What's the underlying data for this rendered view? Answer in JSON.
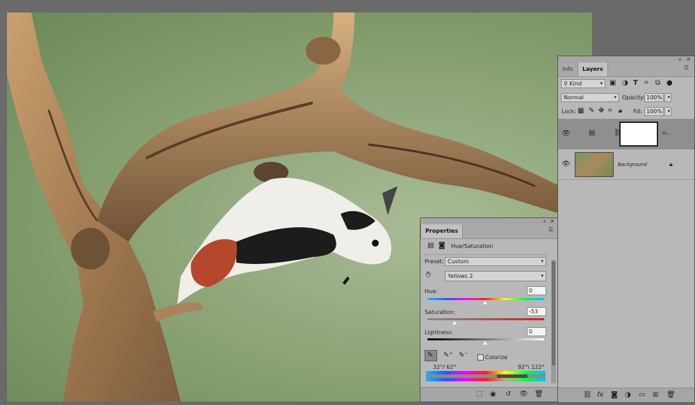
{
  "layers_panel": {
    "tabs": [
      {
        "label": "Info"
      },
      {
        "label": "Layers"
      }
    ],
    "filter_kind": "Kind",
    "blend_mode": "Normal",
    "opacity_label": "Opacity:",
    "opacity_value": "100%",
    "lock_label": "Lock:",
    "fill_label": "Fill:",
    "fill_value": "100%",
    "layers": [
      {
        "name": "H...",
        "type": "adjustment",
        "selected": true
      },
      {
        "name": "Background",
        "type": "image",
        "locked": true
      }
    ]
  },
  "properties_panel": {
    "title": "Properties",
    "adjustment_name": "Hue/Saturation",
    "preset_label": "Preset:",
    "preset_value": "Custom",
    "channel_value": "Yellows 2",
    "hue_label": "Hue:",
    "hue_value": "0",
    "saturation_label": "Saturation:",
    "saturation_value": "-53",
    "lightness_label": "Lightness:",
    "lightness_value": "0",
    "colorize_label": "Colorize",
    "range_left": "32°/ 62°",
    "range_right": "92°\\ 122°"
  },
  "colors": {
    "panel_bg": "#b8b8b8",
    "canvas_bg": "#93aa80",
    "workspace_bg": "#6a6a6a"
  }
}
